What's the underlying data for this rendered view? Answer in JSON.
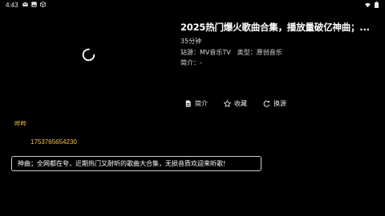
{
  "status_bar": {
    "time": "4:43",
    "left_icons": [
      "mail-icon",
      "image-icon",
      "cube-icon"
    ],
    "right_icons": [
      "wifi-icon",
      "battery-icon"
    ]
  },
  "player": {
    "state": "loading"
  },
  "video": {
    "title": "2025热门爆火歌曲合集，播放量破亿神曲；...",
    "duration": "35分钟",
    "station_label": "站源：MV音乐TV",
    "type_label": "类型：原创音乐",
    "intro_label": "简介：-"
  },
  "actions": {
    "intro": "简介",
    "favorite": "收藏",
    "switch_source": "换源"
  },
  "barrage": {
    "user": "哔哔",
    "id": "1753765654230",
    "message": "神曲；全网都在夸，近期热门又耐听的歌曲大合集，无损音质欢迎来听歌!"
  },
  "colors": {
    "background": "#000000",
    "accent_yellow": "#f5c24a",
    "text": "#ffffff"
  }
}
